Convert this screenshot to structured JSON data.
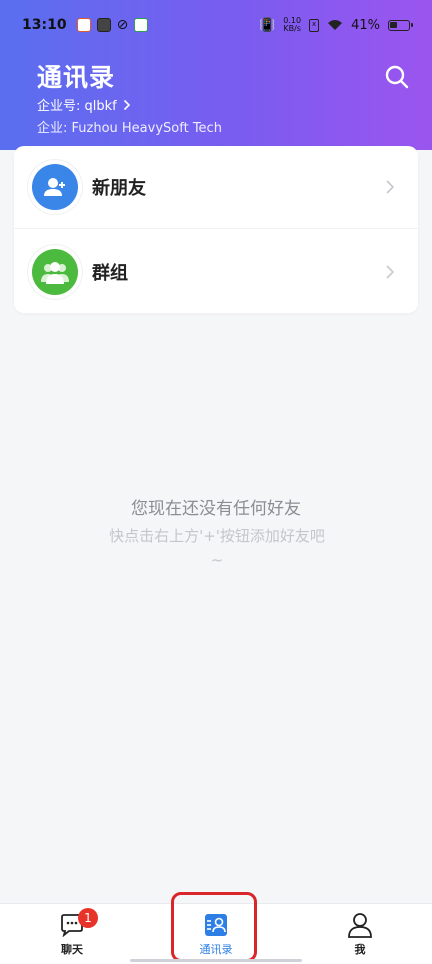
{
  "status_bar": {
    "time": "13:10",
    "net_speed_value": "0.10",
    "net_speed_unit": "KB/s",
    "battery": "41%"
  },
  "header": {
    "title": "通讯录",
    "corp_id": "企业号: qlbkf",
    "corp_name": "企业: Fuzhou HeavySoft Tech",
    "search_icon": "search-icon"
  },
  "contacts_card": {
    "items": [
      {
        "label": "新朋友",
        "icon": "add-user-icon",
        "color": "#3a86e8"
      },
      {
        "label": "群组",
        "icon": "group-icon",
        "color": "#4cba3e"
      }
    ]
  },
  "empty_state": {
    "title": "您现在还没有任何好友",
    "subtitle": "快点击右上方'+'按钮添加好友吧~"
  },
  "bottom_nav": {
    "tabs": [
      {
        "label": "聊天",
        "icon": "chat-icon",
        "badge": "1"
      },
      {
        "label": "通讯录",
        "icon": "contacts-icon",
        "active": true
      },
      {
        "label": "我",
        "icon": "profile-icon"
      }
    ],
    "active_color": "#2d7fe6"
  }
}
